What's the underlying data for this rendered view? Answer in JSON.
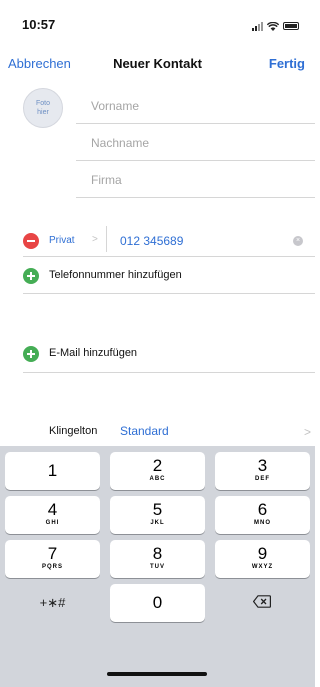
{
  "status_bar": {
    "time": "10:57"
  },
  "nav": {
    "cancel": "Abbrechen",
    "title": "Neuer Kontakt",
    "done": "Fertig"
  },
  "photo": {
    "label_line1": "Foto",
    "label_line2": "hier"
  },
  "fields": {
    "first_name_placeholder": "Vorname",
    "last_name_placeholder": "Nachname",
    "company_placeholder": "Firma"
  },
  "phone_entry": {
    "label": "Privat",
    "chevron": ">",
    "value": "012 345689"
  },
  "add_phone": "Telefonnummer hinzufügen",
  "add_email": "E-Mail hinzufügen",
  "ringtone": {
    "label": "Klingelton",
    "value": "Standard",
    "chevron": ">"
  },
  "keypad": {
    "keys": [
      {
        "num": "1",
        "letters": ""
      },
      {
        "num": "2",
        "letters": "ABC"
      },
      {
        "num": "3",
        "letters": "DEF"
      },
      {
        "num": "4",
        "letters": "GHI"
      },
      {
        "num": "5",
        "letters": "JKL"
      },
      {
        "num": "6",
        "letters": "MNO"
      },
      {
        "num": "7",
        "letters": "PQRS"
      },
      {
        "num": "8",
        "letters": "TUV"
      },
      {
        "num": "9",
        "letters": "WXYZ"
      }
    ],
    "symbols": "+∗#",
    "zero": "0"
  },
  "colors": {
    "accent": "#2f6fd4",
    "remove": "#e84545",
    "add": "#45ad55",
    "keyboard_bg": "#d2d5db"
  },
  "icons": {
    "signal": "signal-icon",
    "wifi": "wifi-icon",
    "battery": "battery-icon",
    "remove": "minus-circle-icon",
    "add": "plus-circle-icon",
    "clear": "clear-icon",
    "delete": "backspace-icon"
  }
}
